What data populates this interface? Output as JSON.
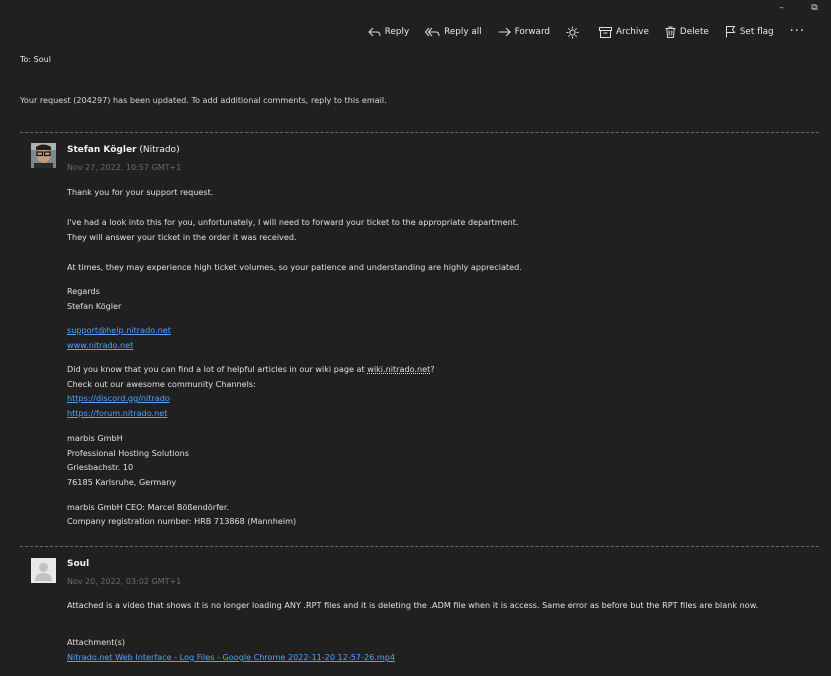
{
  "window": {
    "minimize": "–",
    "restore": "⧉"
  },
  "toolbar": {
    "reply": "Reply",
    "reply_all": "Reply all",
    "forward": "Forward",
    "archive": "Archive",
    "delete": "Delete",
    "set_flag": "Set flag",
    "more": "···"
  },
  "to_line": "To: Soul",
  "intro": "Your request (204297) has been updated. To add additional comments, reply to this email.",
  "message1": {
    "author": "Stefan Kögler",
    "org": " (Nitrado)",
    "date": "Nov 27, 2022, 10:57 GMT+1",
    "lines": {
      "l1": "Thank you for your support request.",
      "l2": "I've had a look into this for you, unfortunately, I will need to forward your ticket to the appropriate department.",
      "l3": "They will answer your ticket in the order it was received.",
      "l4": "At times, they may experience high ticket volumes, so your patience and understanding are highly appreciated.",
      "l5": "Regards",
      "l6": "Stefan Kögler",
      "email": "support@help.nitrado.net",
      "web": "www.nitrado.net",
      "l7a": "Did you know that you can find a lot of helpful articles in our wiki page at ",
      "l7b": "wiki.nitrado.net",
      "l7c": "?",
      "l8": "Check out our awesome community Channels:",
      "discord": "https://discord.gg/nitrado",
      "forum": "https://forum.nitrado.net",
      "c1": "marbis GmbH",
      "c2": "Professional Hosting Solutions",
      "c3": "Griesbachstr. 10",
      "c4": "76185 Karlsruhe, Germany",
      "c5": "marbis GmbH CEO: Marcel Bößendörfer.",
      "c6": "Company registration number: HRB 713868 (Mannheim)"
    }
  },
  "message2": {
    "author": "Soul",
    "date": "Nov 20, 2022, 03:02 GMT+1",
    "body": "Attached is a video that shows it is no longer loading ANY .RPT files and it is deleting the .ADM file when it is access. Same error as before but the RPT files are blank now.",
    "attachments_label": "Attachment(s)",
    "attachment": "Nitrado.net Web Interface - Log Files - Google Chrome 2022-11-20 12-57-26.mp4"
  }
}
